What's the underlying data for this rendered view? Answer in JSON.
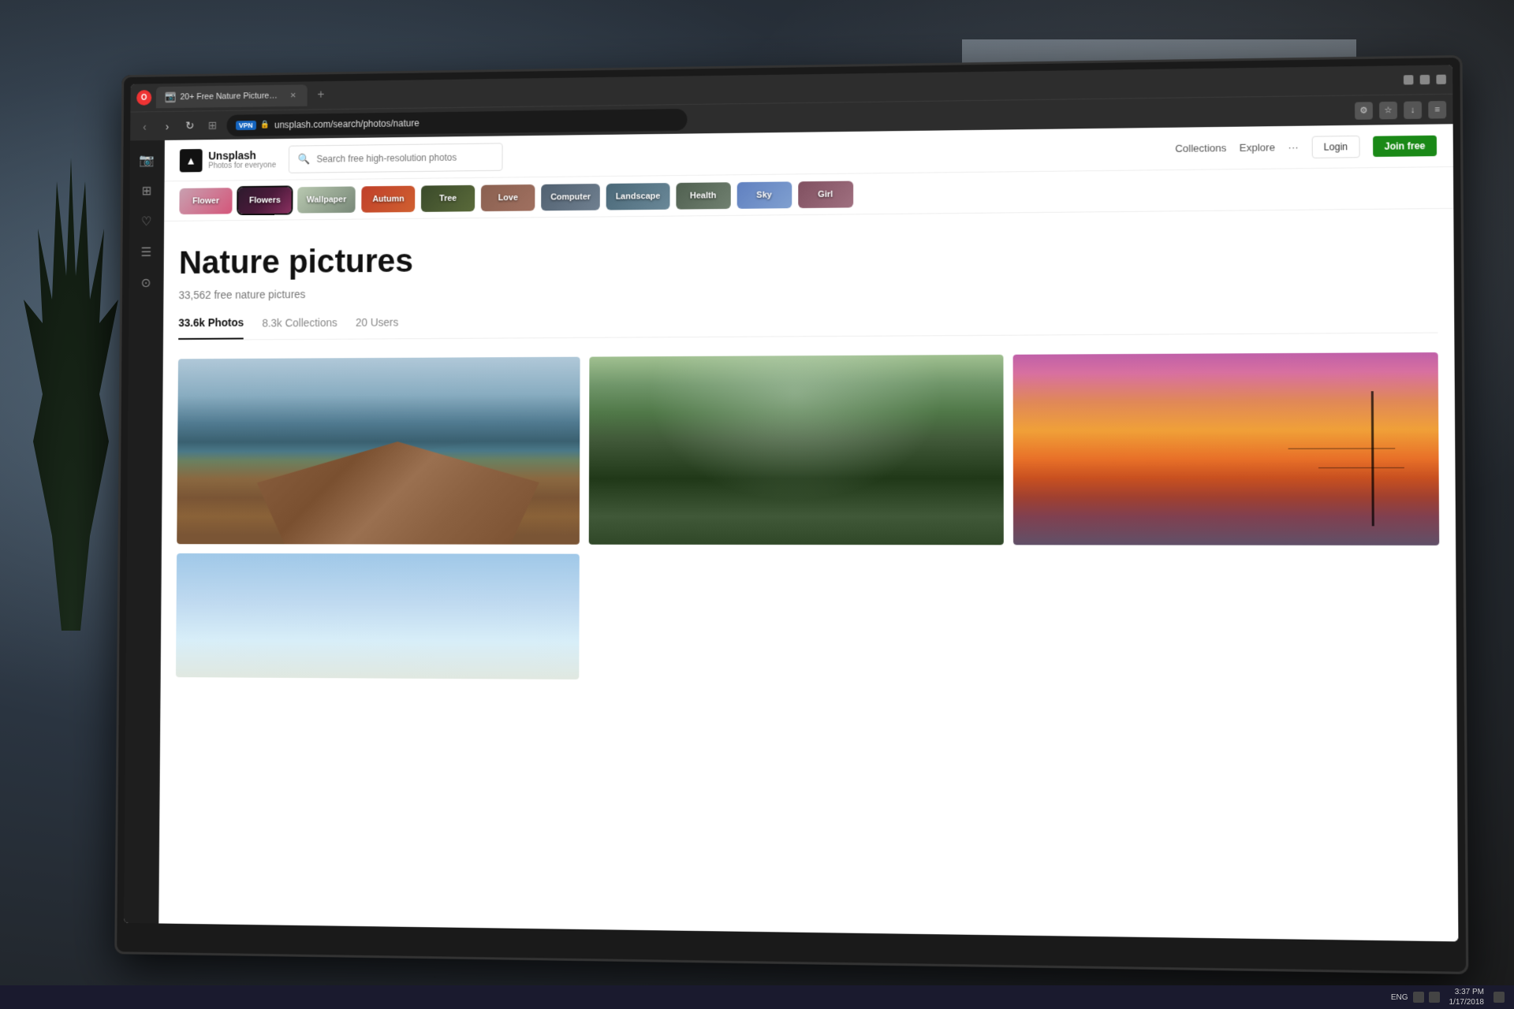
{
  "browser": {
    "tab": {
      "title": "20+ Free Nature Pictures &...",
      "favicon": "📷"
    },
    "url": "unsplash.com/search/photos/nature",
    "vpn_label": "VPN",
    "nav": {
      "back": "‹",
      "forward": "›",
      "reload": "↻",
      "grid": "⊞"
    }
  },
  "sidebar": {
    "icons": [
      {
        "name": "camera",
        "symbol": "📷",
        "active": false
      },
      {
        "name": "grid",
        "symbol": "⊞",
        "active": false
      },
      {
        "name": "heart",
        "symbol": "♡",
        "active": false
      },
      {
        "name": "layers",
        "symbol": "☰",
        "active": false
      },
      {
        "name": "clock",
        "symbol": "⏰",
        "active": false
      }
    ]
  },
  "unsplash": {
    "logo_name": "Unsplash",
    "logo_tagline": "Photos for everyone",
    "search_placeholder": "Search free high-resolution photos",
    "nav": {
      "collections": "Collections",
      "explore": "Explore",
      "more": "···",
      "login": "Login",
      "join": "Join free"
    },
    "categories": [
      {
        "label": "Flower",
        "bg_class": "chip-flower-bg"
      },
      {
        "label": "Flowers",
        "bg_class": "chip-flowers-bg",
        "active": true
      },
      {
        "label": "Wallpaper",
        "bg_class": "chip-wallpaper-bg"
      },
      {
        "label": "Autumn",
        "bg_class": "chip-autumn-bg"
      },
      {
        "label": "Tree",
        "bg_class": "chip-tree-bg"
      },
      {
        "label": "Love",
        "bg_class": "chip-love-bg"
      },
      {
        "label": "Computer",
        "bg_class": "chip-computer-bg"
      },
      {
        "label": "Landscape",
        "bg_class": "chip-landscape-bg"
      },
      {
        "label": "Health",
        "bg_class": "chip-health-bg"
      },
      {
        "label": "Sky",
        "bg_class": "chip-sky-bg"
      },
      {
        "label": "Girl",
        "bg_class": "chip-girl-bg"
      }
    ],
    "page": {
      "title": "Nature pictures",
      "subtitle": "33,562 free nature pictures",
      "tabs": [
        {
          "label": "33.6k Photos",
          "count": "",
          "active": true
        },
        {
          "label": "8.3k Collections",
          "count": "",
          "active": false
        },
        {
          "label": "20 Users",
          "count": "",
          "active": false
        }
      ]
    }
  },
  "taskbar": {
    "time": "3:37 PM",
    "date": "1/17/2018",
    "lang": "ENG"
  }
}
